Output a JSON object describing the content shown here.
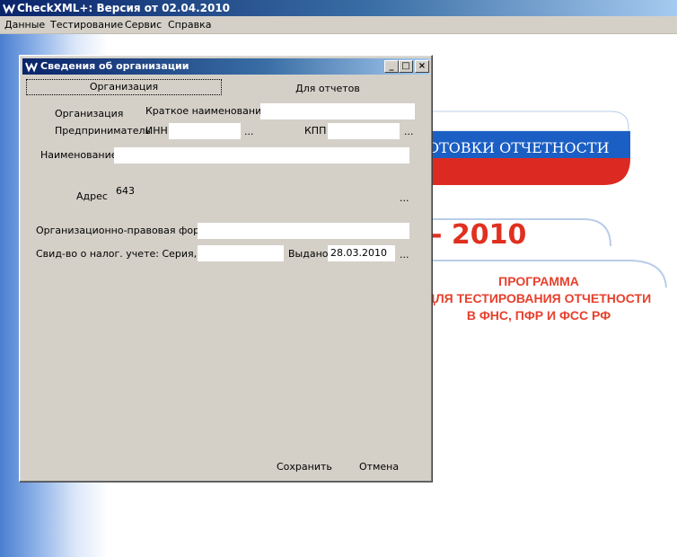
{
  "app": {
    "title": "CheckXML+: Версия от 02.04.2010"
  },
  "menu": {
    "items": [
      "Данные",
      "Тестирование",
      "Сервис",
      "Справка"
    ]
  },
  "splash": {
    "band_text": "ОТОВКИ ОТЧЕТНОСТИ",
    "year_text": "- 2010",
    "program_lines": [
      "ПРОГРАММА",
      "ДЛЯ ТЕСТИРОВАНИЯ ОТЧЕТНОСТИ",
      "В ФНС, ПФР И ФСС РФ"
    ],
    "colors": {
      "blue": "#1c5fc4",
      "red": "#dc2a22",
      "accent_text": "#e8402c"
    }
  },
  "dialog": {
    "title": "Сведения об организации",
    "tabs": [
      {
        "label": "Организация",
        "active": true
      },
      {
        "label": "Для отчетов",
        "active": false
      }
    ],
    "radio": {
      "organization": "Организация",
      "entrepreneur": "Предприниматель"
    },
    "fields": {
      "short_name_label": "Краткое наименование",
      "short_name_value": "",
      "inn_label": "ИНН",
      "inn_value": "",
      "kpp_label": "КПП",
      "kpp_value": "",
      "name_label": "Наименование",
      "name_value": "",
      "address_label": "Адрес",
      "address_value": "643",
      "legal_form_label": "Организационно-правовая форма",
      "legal_form_value": "",
      "certificate_label": "Свид-во о налог. учете: Серия, №",
      "certificate_value": "",
      "issued_label": "Выдано",
      "issued_value": "28.03.2010"
    },
    "ellipsis": "...",
    "buttons": {
      "save": "Сохранить",
      "cancel": "Отмена"
    },
    "title_buttons": {
      "minimize": "_",
      "maximize": "□",
      "close": "×"
    }
  }
}
